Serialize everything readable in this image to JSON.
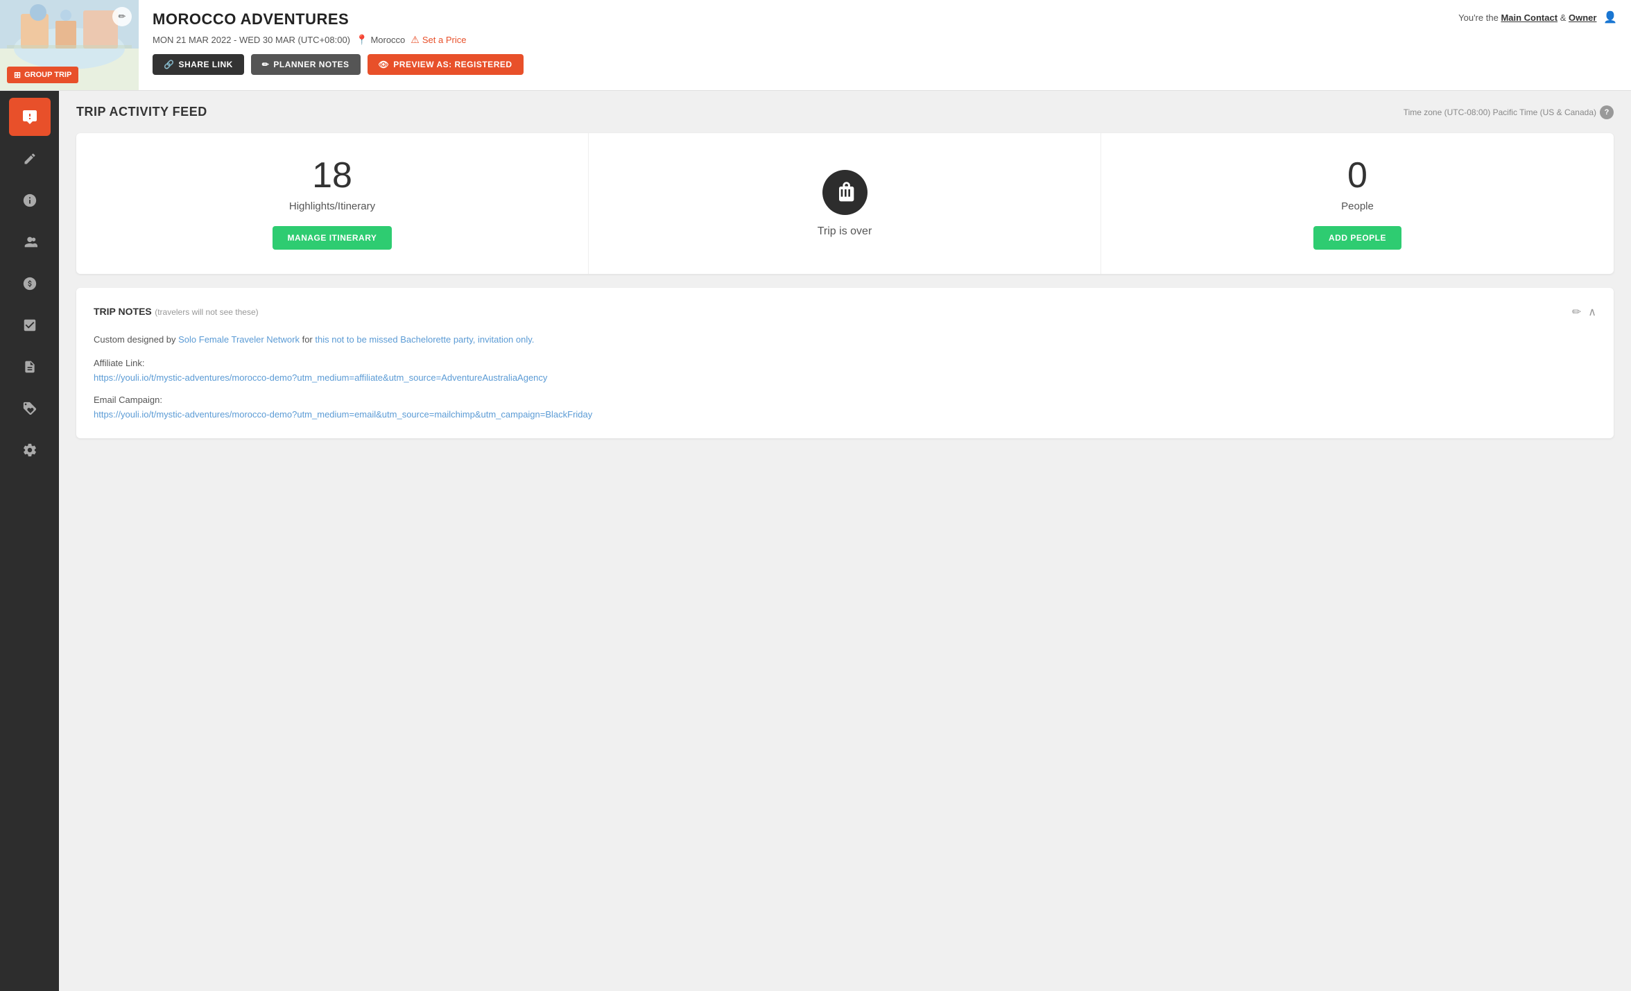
{
  "header": {
    "trip_title": "MOROCCO ADVENTURES",
    "dates": "MON 21 MAR 2022 - WED 30 MAR (UTC+08:00)",
    "location": "Morocco",
    "set_price_label": "Set a Price",
    "group_trip_badge": "GROUP TRIP",
    "edit_tooltip": "Edit",
    "share_link_label": "SHARE LINK",
    "planner_notes_label": "PLANNER NOTES",
    "preview_label": "PREVIEW AS: REGISTERED",
    "user_info": "You're the",
    "main_contact": "Main Contact",
    "and": "&",
    "owner": "Owner"
  },
  "sidebar": {
    "items": [
      {
        "id": "activity-feed",
        "icon": "💬",
        "active": true
      },
      {
        "id": "edit",
        "icon": "✏️",
        "active": false
      },
      {
        "id": "info",
        "icon": "ℹ",
        "active": false
      },
      {
        "id": "people",
        "icon": "👤",
        "active": false
      },
      {
        "id": "pricing",
        "icon": "$",
        "active": false
      },
      {
        "id": "checklist",
        "icon": "✓",
        "active": false
      },
      {
        "id": "documents",
        "icon": "📄",
        "active": false
      },
      {
        "id": "discount",
        "icon": "%",
        "active": false
      },
      {
        "id": "settings",
        "icon": "🔧",
        "active": false
      }
    ]
  },
  "main": {
    "title": "TRIP ACTIVITY FEED",
    "timezone_label": "Time zone (UTC-08:00) Pacific Time (US & Canada)",
    "cards": [
      {
        "number": "18",
        "label": "Highlights/Itinerary",
        "button_label": "MANAGE ITINERARY",
        "type": "itinerary"
      },
      {
        "icon": "luggage",
        "status": "Trip is over",
        "type": "status"
      },
      {
        "number": "0",
        "label": "People",
        "button_label": "ADD PEOPLE",
        "type": "people"
      }
    ],
    "trip_notes": {
      "title": "TRIP NOTES",
      "subtitle": "(travelers will not see these)",
      "content": "Custom designed by Solo Female Traveler Network for this not to be missed Bachelorette party, invitation only.",
      "affiliate_label": "Affiliate Link:",
      "affiliate_url": "https://youli.io/t/mystic-adventures/morocco-demo?utm_medium=affiliate&utm_source=AdventureAustraliaAgency",
      "email_campaign_label": "Email Campaign:",
      "email_campaign_url": "https://youli.io/t/mystic-adventures/morocco-demo?utm_medium=email&utm_source=mailchimp&utm_campaign=BlackFriday"
    }
  }
}
